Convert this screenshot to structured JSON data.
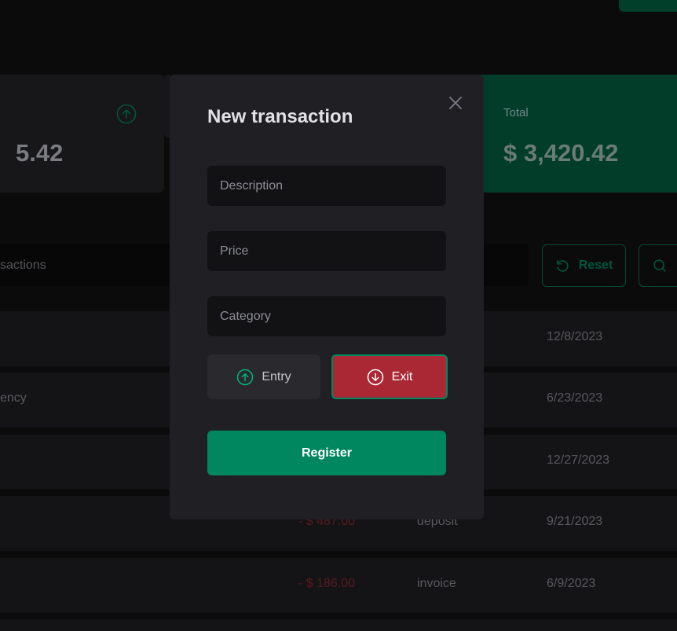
{
  "background": {
    "summary": {
      "income_value": "5.42",
      "total_title": "Total",
      "total_value": "$ 3,420.42"
    },
    "search": {
      "placeholder_text": "sactions",
      "reset_label": "Reset"
    },
    "rows": [
      {
        "description": "",
        "price": "",
        "category": "",
        "date": "12/8/2023"
      },
      {
        "description": "ency",
        "price": "",
        "category": "",
        "date": "6/23/2023"
      },
      {
        "description": "",
        "price": "",
        "category": "",
        "date": "12/27/2023"
      },
      {
        "description": "",
        "price": "- $ 487.00",
        "category": "deposit",
        "date": "9/21/2023"
      },
      {
        "description": "",
        "price": "- $ 186.00",
        "category": "invoice",
        "date": "6/9/2023"
      }
    ]
  },
  "modal": {
    "title": "New transaction",
    "fields": {
      "description_placeholder": "Description",
      "price_placeholder": "Price",
      "category_placeholder": "Category"
    },
    "type": {
      "entry_label": "Entry",
      "exit_label": "Exit",
      "selected": "Exit"
    },
    "register_label": "Register"
  },
  "colors": {
    "accent_green": "#00875f",
    "exit_red": "#aa2834",
    "modal_bg": "#202024",
    "input_bg": "#121214"
  },
  "icons": [
    "close-icon",
    "arrow-circle-up-icon",
    "arrow-circle-down-icon",
    "reset-icon",
    "search-icon"
  ]
}
